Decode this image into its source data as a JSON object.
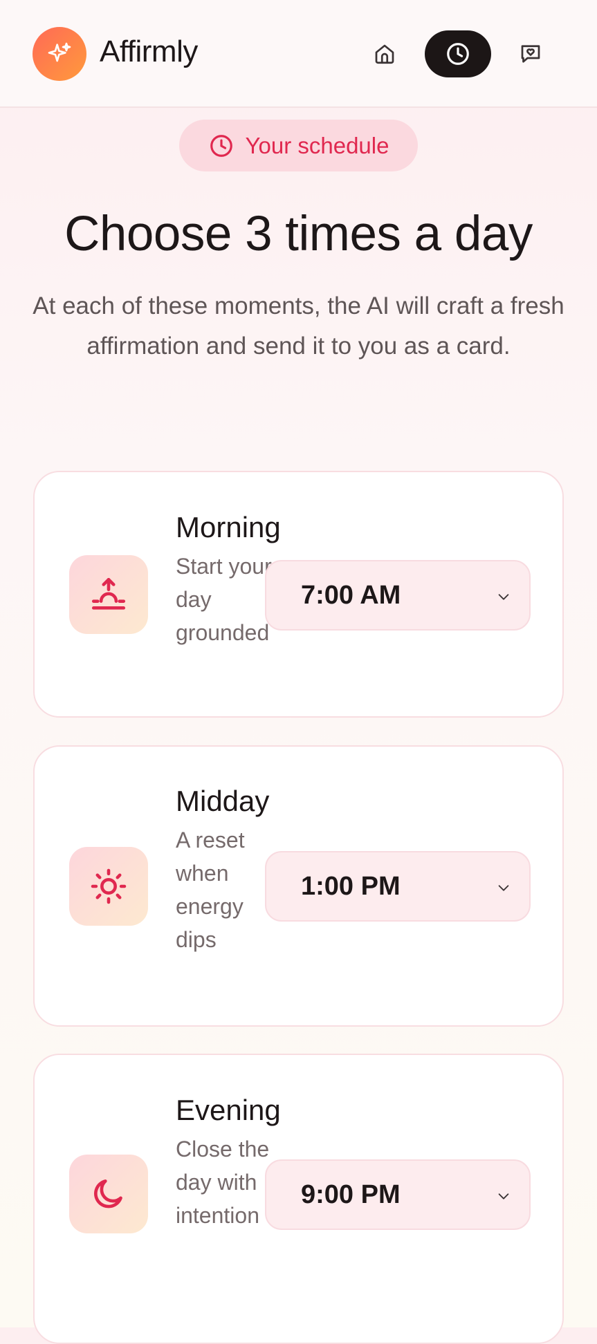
{
  "app": {
    "name": "Affirmly"
  },
  "nav": {
    "home_icon": "home-icon",
    "schedule_icon": "clock-icon",
    "chat_icon": "message-heart-icon"
  },
  "badge": {
    "label": "Your schedule",
    "icon": "clock-icon"
  },
  "heading": {
    "title": "Choose 3 times a day",
    "subtitle": "At each of these moments, the AI will craft a fresh affirmation and send it to you as a card."
  },
  "slots": [
    {
      "name": "Morning",
      "description": "Start your day grounded",
      "time": "7:00 AM",
      "icon": "sunrise-icon"
    },
    {
      "name": "Midday",
      "description": "A reset when energy dips",
      "time": "1:00 PM",
      "icon": "sun-icon"
    },
    {
      "name": "Evening",
      "description": "Close the day with intention",
      "time": "9:00 PM",
      "icon": "moon-icon"
    }
  ],
  "colors": {
    "accent": "#e0284f",
    "brand_gradient_start": "#ff6a56",
    "brand_gradient_end": "#ff9a3c",
    "active_nav": "#1c1616"
  }
}
